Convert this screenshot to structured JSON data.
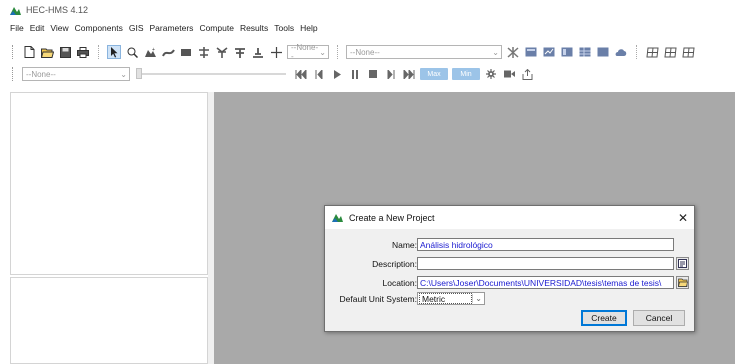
{
  "window": {
    "title": "HEC-HMS 4.12",
    "icon": "hec-hms-logo"
  },
  "menu": [
    "File",
    "Edit",
    "View",
    "Components",
    "GIS",
    "Parameters",
    "Compute",
    "Results",
    "Tools",
    "Help"
  ],
  "toolbar1": {
    "icons": [
      "new-project-icon",
      "open-project-icon",
      "save-project-icon",
      "print-icon",
      "arrow-tool-icon",
      "zoom-tool-icon",
      "subbasin-tool-icon",
      "reach-tool-icon",
      "reservoir-tool-icon",
      "junction-tool-icon",
      "diversion-tool-icon",
      "source-tool-icon",
      "sink-tool-icon"
    ],
    "combo_small": "--None--",
    "combo_large": "--None--",
    "right_icons": [
      "compute-icon",
      "global-summary-icon",
      "element-graph-icon",
      "summary-table-icon",
      "time-series-table-icon",
      "cloud-icon",
      "grid-icon-1",
      "grid-icon-2",
      "grid-icon-3"
    ]
  },
  "toolbar2": {
    "combo": "--None--",
    "slider_position": 0.0,
    "max_label": "Max",
    "min_label": "Min"
  },
  "dialog": {
    "title": "Create a New Project",
    "name_label": "Name:",
    "name_value": "Análisis hidrológico",
    "description_label": "Description:",
    "description_value": "",
    "location_label": "Location:",
    "location_value": "C:\\Users\\Joser\\Documents\\UNIVERSIDAD\\tesis\\temas de tesis\\",
    "unit_label": "Default Unit System:",
    "unit_value": "Metric",
    "create_label": "Create",
    "cancel_label": "Cancel"
  },
  "colors": {
    "desktop": "#a9a9a9",
    "accent": "#0078d7",
    "field_text": "#1a1ad0",
    "pill": "#9cc4e8"
  }
}
